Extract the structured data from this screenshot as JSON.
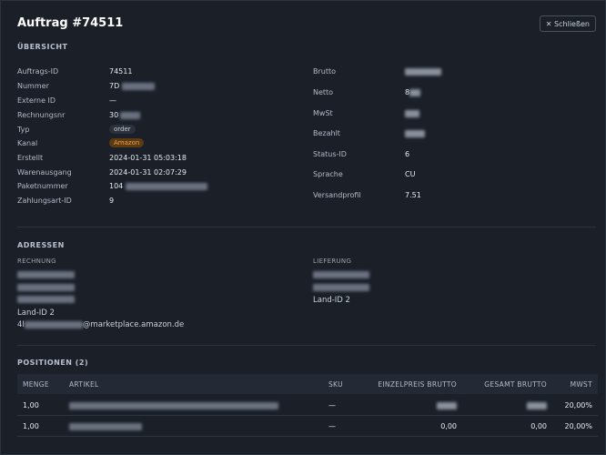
{
  "header": {
    "title": "Auftrag #74511",
    "close_label": "✕ Schließen"
  },
  "overview": {
    "title": "ÜBERSICHT",
    "left": [
      {
        "key": "Auftrags-ID",
        "value": "74511"
      },
      {
        "key": "Nummer",
        "value": "7D"
      },
      {
        "key": "Externe ID",
        "value": "—"
      },
      {
        "key": "Rechnungsnr",
        "value": "30"
      },
      {
        "key": "Typ",
        "value": "order"
      },
      {
        "key": "Kanal",
        "value": "Amazon"
      },
      {
        "key": "Erstellt",
        "value": "2024-01-31 05:03:18"
      },
      {
        "key": "Warenausgang",
        "value": "2024-01-31 02:07:29"
      },
      {
        "key": "Paketnummer",
        "value": "104"
      },
      {
        "key": "Zahlungsart-ID",
        "value": "9"
      }
    ],
    "right": [
      {
        "key": "Brutto",
        "value": ""
      },
      {
        "key": "Netto",
        "value": "8"
      },
      {
        "key": "MwSt",
        "value": ""
      },
      {
        "key": "Bezahlt",
        "value": ""
      },
      {
        "key": "Status-ID",
        "value": "6"
      },
      {
        "key": "Sprache",
        "value": "CU"
      },
      {
        "key": "Versandprofil",
        "value": "7.51"
      }
    ]
  },
  "addresses": {
    "title": "ADRESSEN",
    "billing": {
      "label": "RECHNUNG",
      "land": "Land-ID 2",
      "email_prefix": "4I",
      "email_suffix": "@marketplace.amazon.de"
    },
    "shipping": {
      "label": "LIEFERUNG",
      "land": "Land-ID 2"
    }
  },
  "positions": {
    "title": "POSITIONEN (2)",
    "columns": [
      "MENGE",
      "ARTIKEL",
      "SKU",
      "EINZELPREIS BRUTTO",
      "GESAMT BRUTTO",
      "MWST"
    ],
    "rows": [
      {
        "menge": "1,00",
        "sku": "—",
        "einzelpreis": "",
        "gesamt": "",
        "mwst": "20,00%"
      },
      {
        "menge": "1,00",
        "sku": "—",
        "einzelpreis": "0,00",
        "gesamt": "0,00",
        "mwst": "20,00%"
      }
    ]
  },
  "colors": {
    "background": "#1a1f28",
    "accent_amber": "#f0a040",
    "badge_gray": "#2b313b"
  }
}
